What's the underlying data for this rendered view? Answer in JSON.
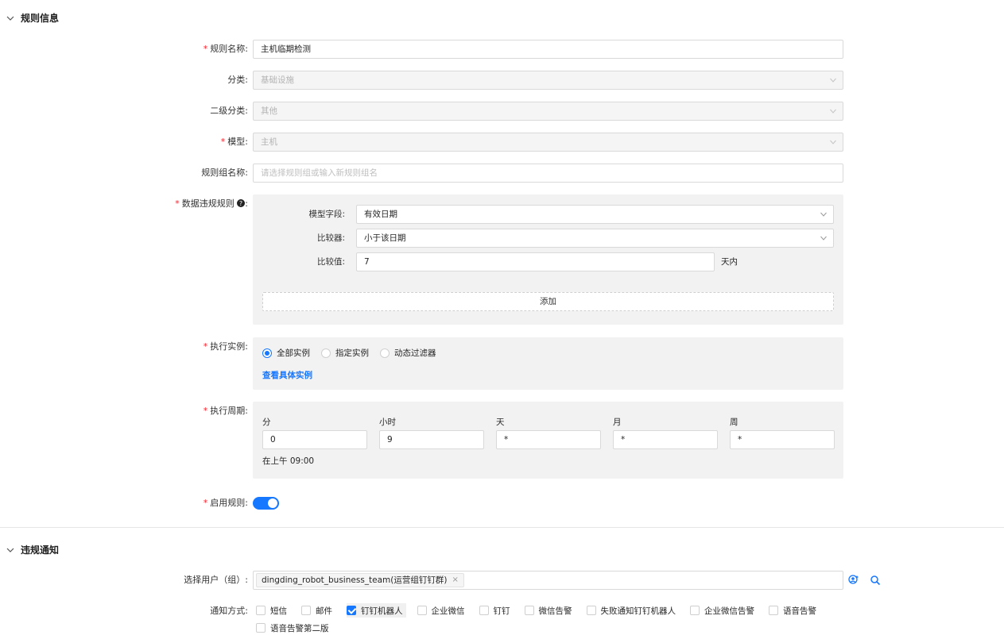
{
  "rule_section": {
    "title": "规则信息",
    "rule_name": {
      "label": "规则名称:",
      "value": "主机临期检测"
    },
    "category": {
      "label": "分类:",
      "value": "基础设施"
    },
    "sub_category": {
      "label": "二级分类:",
      "value": "其他"
    },
    "model": {
      "label": "模型:",
      "value": "主机"
    },
    "rule_group": {
      "label": "规则组名称:",
      "placeholder": "请选择规则组或输入新规则组名"
    },
    "violation_rule": {
      "label": "数据违规规则",
      "help_icon": "question-circle-icon",
      "model_field": {
        "label": "模型字段:",
        "value": "有效日期"
      },
      "comparator": {
        "label": "比较器:",
        "value": "小于该日期"
      },
      "compare_value": {
        "label": "比较值:",
        "value": "7",
        "suffix": "天内"
      },
      "add_label": "添加"
    },
    "instances": {
      "label": "执行实例:",
      "options": [
        "全部实例",
        "指定实例",
        "动态过滤器"
      ],
      "selected": "全部实例",
      "view_link": "查看具体实例"
    },
    "schedule": {
      "label": "执行周期:",
      "columns": [
        {
          "header": "分",
          "value": "0"
        },
        {
          "header": "小时",
          "value": "9"
        },
        {
          "header": "天",
          "value": "*"
        },
        {
          "header": "月",
          "value": "*"
        },
        {
          "header": "周",
          "value": "*"
        }
      ],
      "summary": "在上午 09:00"
    },
    "enable": {
      "label": "启用规则:",
      "on": true
    }
  },
  "notify_section": {
    "title": "违规通知",
    "users": {
      "label": "选择用户（组）:",
      "tag": "dingding_robot_business_team(运营组钉钉群)"
    },
    "methods": {
      "label": "通知方式:",
      "options": [
        {
          "label": "短信",
          "checked": false
        },
        {
          "label": "邮件",
          "checked": false
        },
        {
          "label": "钉钉机器人",
          "checked": true
        },
        {
          "label": "企业微信",
          "checked": false
        },
        {
          "label": "钉钉",
          "checked": false
        },
        {
          "label": "微信告警",
          "checked": false
        },
        {
          "label": "失败通知钉钉机器人",
          "checked": false
        },
        {
          "label": "企业微信告警",
          "checked": false
        },
        {
          "label": "语音告警",
          "checked": false
        },
        {
          "label": "语音告警第二版",
          "checked": false
        }
      ]
    }
  },
  "colors": {
    "accent": "#1677ff",
    "required": "#f5222d",
    "panel_bg": "#f2f2f2"
  }
}
